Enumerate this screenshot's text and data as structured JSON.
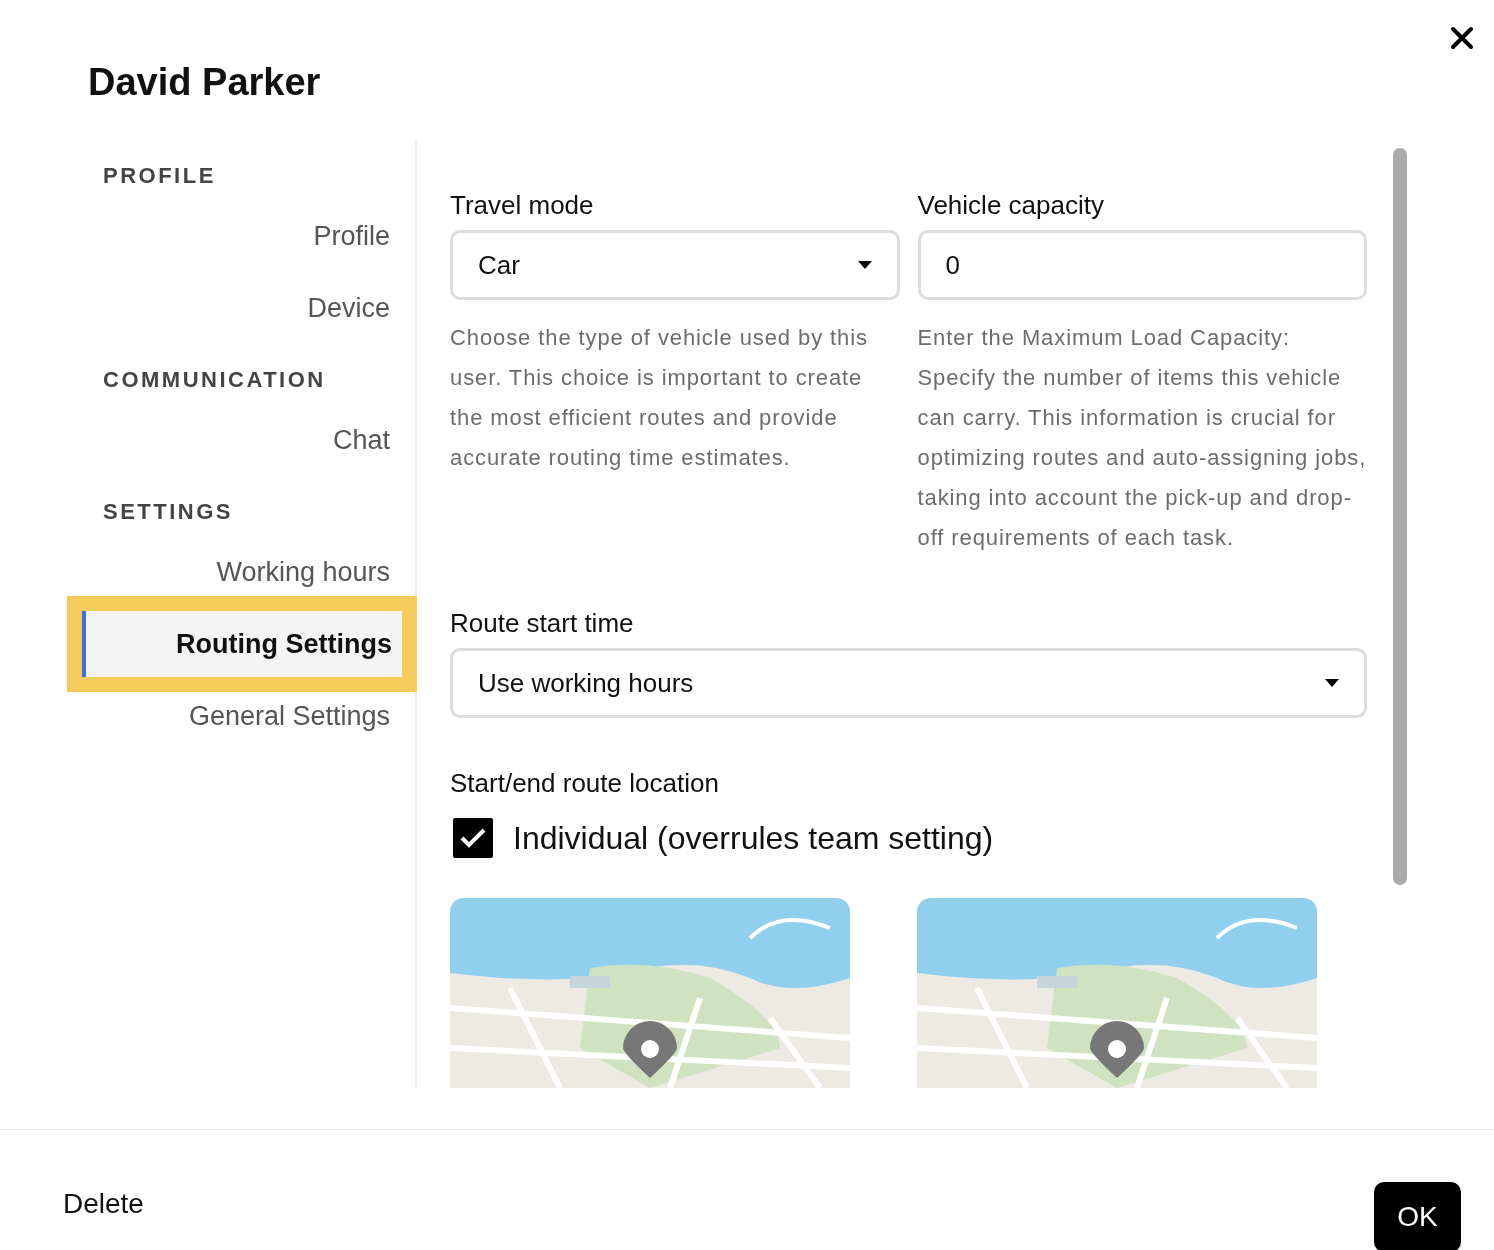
{
  "dialog": {
    "title": "David Parker"
  },
  "sidebar": {
    "sections": [
      {
        "heading": "PROFILE",
        "items": [
          {
            "label": "Profile",
            "selected": false
          },
          {
            "label": "Device",
            "selected": false
          }
        ]
      },
      {
        "heading": "COMMUNICATION",
        "items": [
          {
            "label": "Chat",
            "selected": false
          }
        ]
      },
      {
        "heading": "SETTINGS",
        "items": [
          {
            "label": "Working hours",
            "selected": false
          },
          {
            "label": "Routing Settings",
            "selected": true
          },
          {
            "label": "General Settings",
            "selected": false
          }
        ]
      }
    ]
  },
  "fields": [
    {
      "kind": "select",
      "label": "Travel mode",
      "value": "Car",
      "help": "Choose the type of vehicle used by this user. This choice is important to create the most efficient routes and provide accurate routing time estimates."
    },
    {
      "kind": "input",
      "label": "Vehicle capacity",
      "value": "0",
      "help": "Enter the Maximum Load Capacity: Specify the number of items this vehicle can carry. This information is crucial for optimizing routes and auto-assigning jobs, taking into account the pick-up and drop-off requirements of each task."
    }
  ],
  "route_start": {
    "label": "Route start time",
    "value": "Use working hours"
  },
  "location": {
    "label": "Start/end route location",
    "checkbox": {
      "label": "Individual (overrules team setting)",
      "checked": true
    }
  },
  "footer": {
    "delete": "Delete",
    "ok": "OK"
  }
}
